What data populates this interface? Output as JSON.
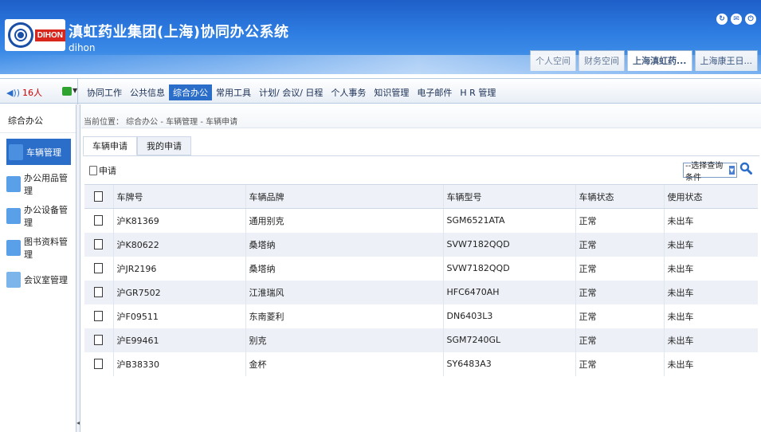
{
  "header": {
    "title": "滇虹药业集团(上海)协同办公系统",
    "subtitle": "dihon",
    "logo_text": "DIHON",
    "tabs": [
      {
        "label": "个人空间",
        "active": false
      },
      {
        "label": "财务空间",
        "active": false
      },
      {
        "label": "上海滇虹药...",
        "active": true
      },
      {
        "label": "上海康王日...",
        "active": false
      }
    ]
  },
  "toolbar": {
    "online_count": "16人",
    "menu": [
      {
        "label": "协同工作",
        "active": false
      },
      {
        "label": "公共信息",
        "active": false
      },
      {
        "label": "综合办公",
        "active": true
      },
      {
        "label": "常用工具",
        "active": false
      },
      {
        "label": "计划/ 会议/ 日程",
        "active": false
      },
      {
        "label": "个人事务",
        "active": false
      },
      {
        "label": "知识管理",
        "active": false
      },
      {
        "label": "电子邮件",
        "active": false
      },
      {
        "label": "H R 管理",
        "active": false
      }
    ]
  },
  "sidebar": {
    "title": "综合办公",
    "items": [
      {
        "label": "车辆管理",
        "active": true,
        "icon": "car-icon",
        "color": "#4a8fe0"
      },
      {
        "label": "办公用品管理",
        "active": false,
        "icon": "office-supplies-icon",
        "color": "#5aa0e8"
      },
      {
        "label": "办公设备管理",
        "active": false,
        "icon": "office-equipment-icon",
        "color": "#5aa0e8"
      },
      {
        "label": "图书资料管理",
        "active": false,
        "icon": "books-icon",
        "color": "#5aa0e8"
      },
      {
        "label": "会议室管理",
        "active": false,
        "icon": "meeting-room-icon",
        "color": "#7bb5ea"
      }
    ]
  },
  "main": {
    "breadcrumb": "当前位置： 综合办公 - 车辆管理 - 车辆申请",
    "subtabs": [
      {
        "label": "车辆申请",
        "active": true
      },
      {
        "label": "我的申请",
        "active": false
      }
    ],
    "apply_label": "申请",
    "query_placeholder": "--选择查询条件",
    "columns": [
      "车牌号",
      "车辆品牌",
      "车辆型号",
      "车辆状态",
      "使用状态"
    ],
    "rows": [
      [
        "沪K81369",
        "通用别克",
        "SGM6521ATA",
        "正常",
        "未出车"
      ],
      [
        "沪K80622",
        "桑塔纳",
        "SVW7182QQD",
        "正常",
        "未出车"
      ],
      [
        "沪JR2196",
        "桑塔纳",
        "SVW7182QQD",
        "正常",
        "未出车"
      ],
      [
        "沪GR7502",
        "江淮瑞风",
        "HFC6470AH",
        "正常",
        "未出车"
      ],
      [
        "沪F09511",
        "东南菱利",
        "DN6403L3",
        "正常",
        "未出车"
      ],
      [
        "沪E99461",
        "别克",
        "SGM7240GL",
        "正常",
        "未出车"
      ],
      [
        "沪B38330",
        "金杯",
        "SY6483A3",
        "正常",
        "未出车"
      ]
    ]
  }
}
